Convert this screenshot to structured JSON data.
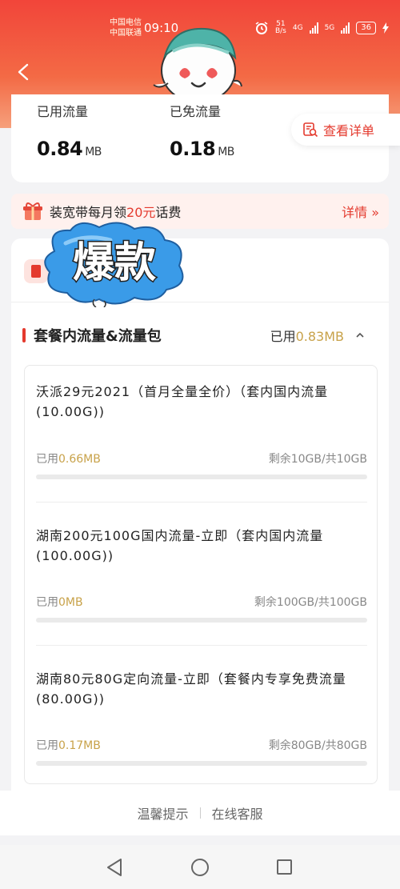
{
  "status": {
    "carrier_1": "中国电信",
    "carrier_2": "中国联通",
    "time": "09:10",
    "net_speed_value": "51",
    "net_speed_unit": "B/s",
    "net_type": "4G",
    "net_type_2": "5G",
    "battery": "36"
  },
  "usage": {
    "used_label": "已用流量",
    "used_value": "0.84",
    "used_unit": "MB",
    "free_label": "已免流量",
    "free_value": "0.18",
    "free_unit": "MB",
    "detail_button": "查看详单"
  },
  "promo": {
    "text_before": "装宽带每月领",
    "highlight": "20元",
    "text_after": "话费",
    "more": "详情 »"
  },
  "sticker": {
    "text": "爆款"
  },
  "section": {
    "title": "套餐内流量&流量包",
    "used_label": "已用",
    "used_value": "0.83MB"
  },
  "packages": [
    {
      "name": "沃派29元2021（首月全量全价）（套内国内流量(10.00G))",
      "used_label": "已用",
      "used_value": "0.66MB",
      "remain": "剩余10GB/共10GB",
      "progress": 0.0
    },
    {
      "name": "湖南200元100G国内流量-立即（套内国内流量(100.00G))",
      "used_label": "已用",
      "used_value": "0MB",
      "remain": "剩余100GB/共100GB",
      "progress": 0.0
    },
    {
      "name": "湖南80元80G定向流量-立即（套餐内专享免费流量(80.00G))",
      "used_label": "已用",
      "used_value": "0.17MB",
      "remain": "剩余80GB/共80GB",
      "progress": 0.0
    }
  ],
  "footer": {
    "tips": "温馨提示",
    "service": "在线客服"
  },
  "colors": {
    "brand_red": "#e43a2e",
    "header_gradient_top": "#f2453a",
    "accent_gold": "#c8a24a",
    "sticker_blue": "#3a9be8"
  },
  "icons": {
    "back": "chevron-left-icon",
    "detail": "list-search-icon",
    "gift": "gift-icon",
    "chevron_up": "chevron-up-icon"
  }
}
